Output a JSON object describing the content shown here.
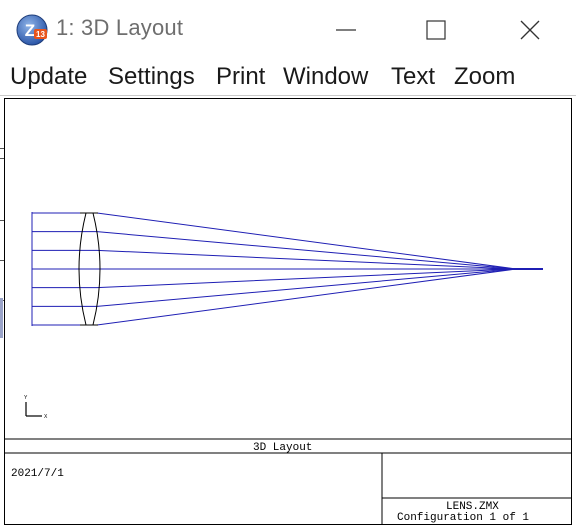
{
  "window": {
    "title": "1: 3D Layout",
    "icon_name": "zemax-app-icon",
    "icon_text": "Z13",
    "controls": [
      "minimize-icon",
      "maximize-icon",
      "close-icon"
    ]
  },
  "menu": [
    {
      "label": "Update"
    },
    {
      "label": "Settings"
    },
    {
      "label": "Print"
    },
    {
      "label": "Window"
    },
    {
      "label": "Text"
    },
    {
      "label": "Zoom"
    }
  ],
  "plot": {
    "ray_color": "#1f1fb4",
    "lens_color": "#000000",
    "num_rays": 7,
    "axis_y_label": "Y",
    "axis_x_label": "X"
  },
  "footer": {
    "plot_title": "3D Layout",
    "date": "2021/7/1",
    "file": "LENS.ZMX",
    "configuration": "Configuration 1 of 1"
  }
}
